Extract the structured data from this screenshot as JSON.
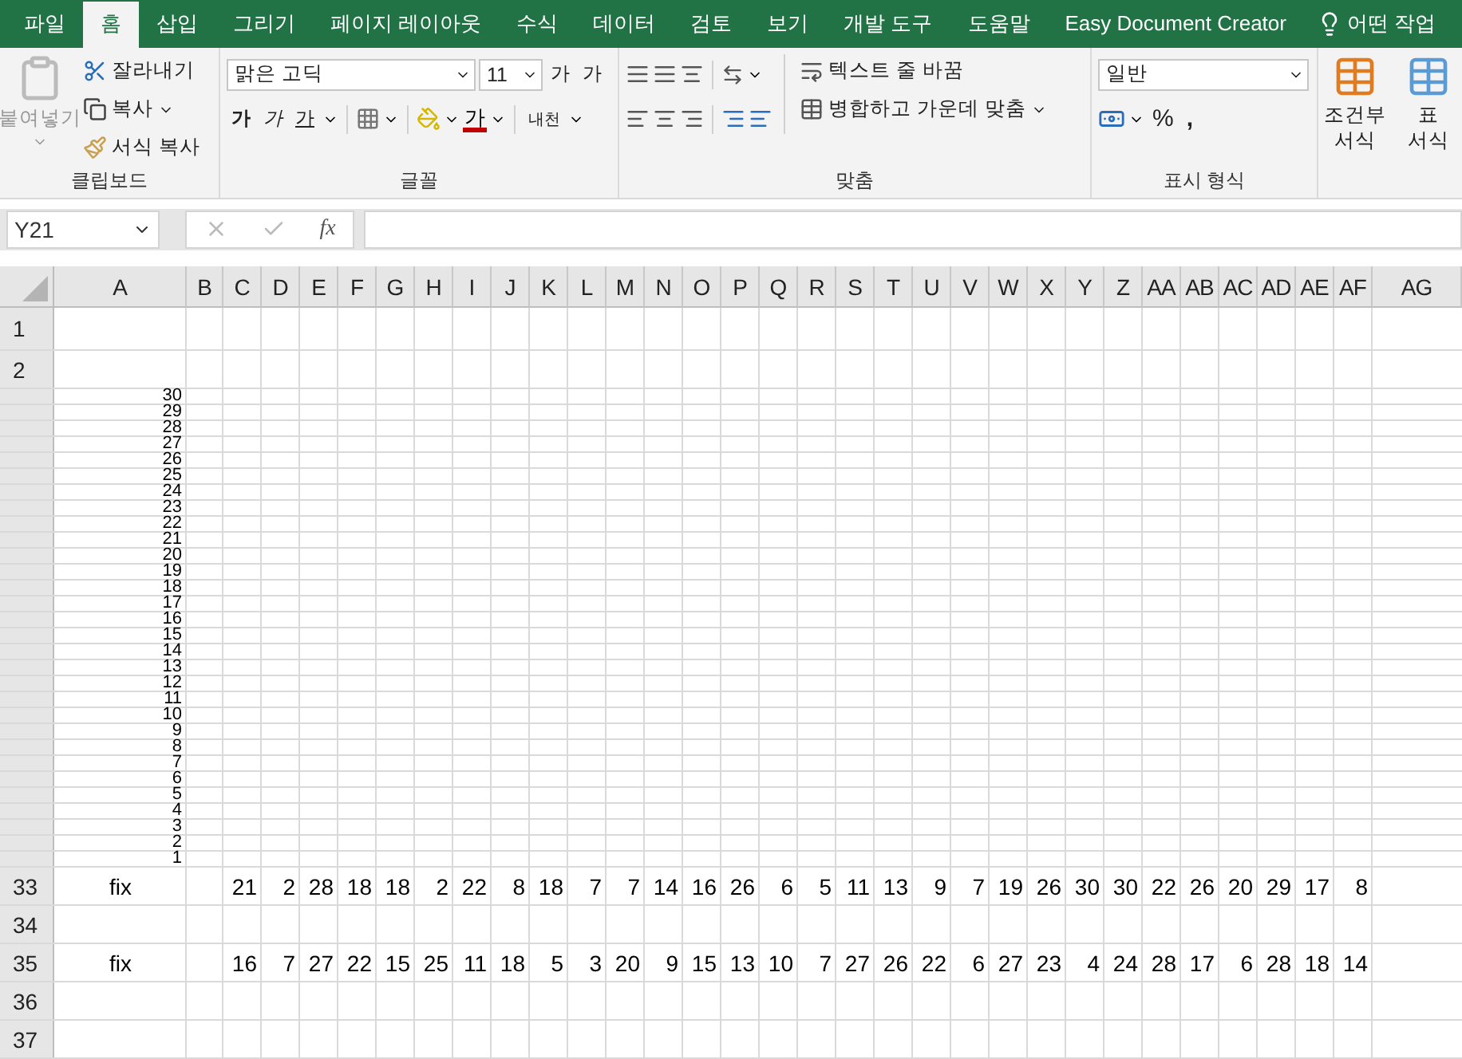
{
  "menu_tabs": [
    {
      "label": "파일",
      "selected": false
    },
    {
      "label": "홈",
      "selected": true
    },
    {
      "label": "삽입",
      "selected": false
    },
    {
      "label": "그리기",
      "selected": false
    },
    {
      "label": "페이지 레이아웃",
      "selected": false
    },
    {
      "label": "수식",
      "selected": false
    },
    {
      "label": "데이터",
      "selected": false
    },
    {
      "label": "검토",
      "selected": false
    },
    {
      "label": "보기",
      "selected": false
    },
    {
      "label": "개발 도구",
      "selected": false
    },
    {
      "label": "도움말",
      "selected": false
    },
    {
      "label": "Easy Document Creator",
      "selected": false
    }
  ],
  "tell_me": {
    "text": "어떤 작업"
  },
  "ribbon": {
    "clipboard": {
      "paste": "붙여넣기",
      "paste_disabled": true,
      "cut": "잘라내기",
      "copy": "복사",
      "format_painter": "서식 복사",
      "label": "클립보드"
    },
    "font": {
      "name": "맑은 고딕",
      "size": "11",
      "grow": "가",
      "shrink": "가",
      "bold": "가",
      "italic": "가",
      "underline": "가",
      "font_color": "가",
      "phonetic": "내천",
      "label": "글꼴"
    },
    "alignment": {
      "wrap_text": "텍스트 줄 바꿈",
      "merge_center": "병합하고 가운데 맞춤",
      "label": "맞춤"
    },
    "number": {
      "format": "일반",
      "percent": "%",
      "comma": ",",
      "label": "표시 형식"
    },
    "styles": {
      "conditional": "조건부 서식",
      "table": "표 서식"
    }
  },
  "formula_bar": {
    "name_box": "Y21",
    "fx": "fx"
  },
  "sheet": {
    "columns": [
      "A",
      "B",
      "C",
      "D",
      "E",
      "F",
      "G",
      "H",
      "I",
      "J",
      "K",
      "L",
      "M",
      "N",
      "O",
      "P",
      "Q",
      "R",
      "S",
      "T",
      "U",
      "V",
      "W",
      "X",
      "Y",
      "Z",
      "AA",
      "AB",
      "AC",
      "AD",
      "AE",
      "AF",
      "AG"
    ],
    "rows": [
      {
        "header": "1",
        "kind": "tall"
      },
      {
        "header": "2",
        "kind": "normal"
      },
      {
        "kind": "compressed",
        "value": "30"
      },
      {
        "kind": "compressed",
        "value": "29"
      },
      {
        "kind": "compressed",
        "value": "28"
      },
      {
        "kind": "compressed",
        "value": "27"
      },
      {
        "kind": "compressed",
        "value": "26"
      },
      {
        "kind": "compressed",
        "value": "25"
      },
      {
        "kind": "compressed",
        "value": "24"
      },
      {
        "kind": "compressed",
        "value": "23"
      },
      {
        "kind": "compressed",
        "value": "22"
      },
      {
        "kind": "compressed",
        "value": "21"
      },
      {
        "kind": "compressed",
        "value": "20"
      },
      {
        "kind": "compressed",
        "value": "19"
      },
      {
        "kind": "compressed",
        "value": "18"
      },
      {
        "kind": "compressed",
        "value": "17"
      },
      {
        "kind": "compressed",
        "value": "16"
      },
      {
        "kind": "compressed",
        "value": "15"
      },
      {
        "kind": "compressed",
        "value": "14"
      },
      {
        "kind": "compressed",
        "value": "13"
      },
      {
        "kind": "compressed",
        "value": "12"
      },
      {
        "kind": "compressed",
        "value": "11"
      },
      {
        "kind": "compressed",
        "value": "10"
      },
      {
        "kind": "compressed",
        "value": "9"
      },
      {
        "kind": "compressed",
        "value": "8"
      },
      {
        "kind": "compressed",
        "value": "7"
      },
      {
        "kind": "compressed",
        "value": "6"
      },
      {
        "kind": "compressed",
        "value": "5"
      },
      {
        "kind": "compressed",
        "value": "4"
      },
      {
        "kind": "compressed",
        "value": "3"
      },
      {
        "kind": "compressed",
        "value": "2"
      },
      {
        "kind": "compressed",
        "value": "1"
      },
      {
        "header": "33",
        "kind": "normal",
        "label": "fix",
        "values": [
          "21",
          "2",
          "28",
          "18",
          "18",
          "2",
          "22",
          "8",
          "18",
          "7",
          "7",
          "14",
          "16",
          "26",
          "6",
          "5",
          "11",
          "13",
          "9",
          "7",
          "19",
          "26",
          "30",
          "30",
          "22",
          "26",
          "20",
          "29",
          "17",
          "8"
        ]
      },
      {
        "header": "34",
        "kind": "normal"
      },
      {
        "header": "35",
        "kind": "normal",
        "label": "fix",
        "values": [
          "16",
          "7",
          "27",
          "22",
          "15",
          "25",
          "11",
          "18",
          "5",
          "3",
          "20",
          "9",
          "15",
          "13",
          "10",
          "7",
          "27",
          "26",
          "22",
          "6",
          "27",
          "23",
          "4",
          "24",
          "28",
          "17",
          "6",
          "28",
          "18",
          "14"
        ]
      },
      {
        "header": "36",
        "kind": "normal"
      },
      {
        "header": "37",
        "kind": "normal"
      }
    ]
  }
}
